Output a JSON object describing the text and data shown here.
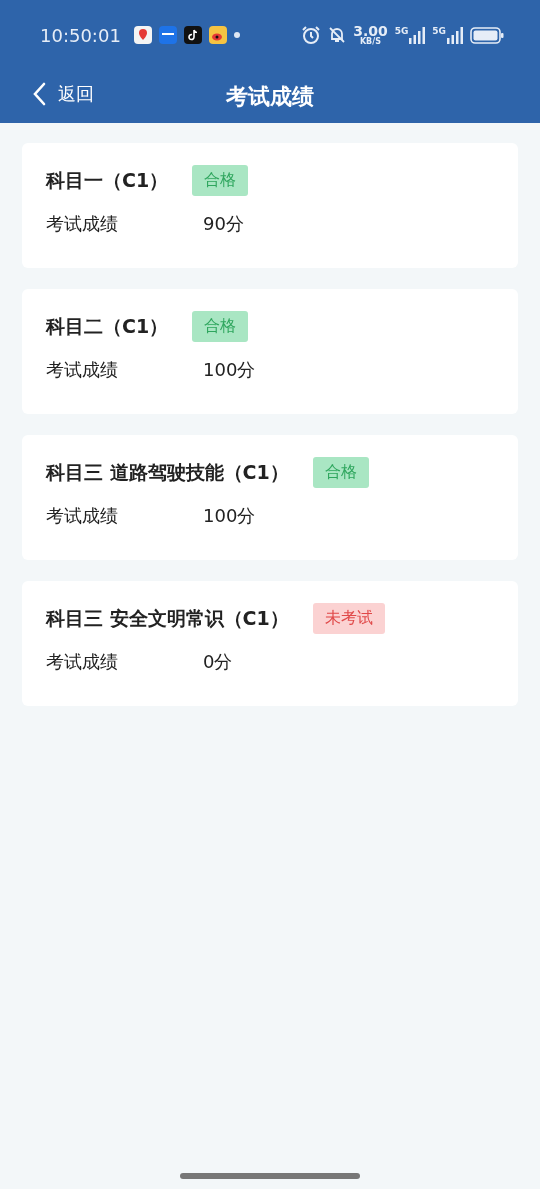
{
  "status_bar": {
    "time": "10:50:01",
    "speed": "3.00",
    "speed_unit": "KB/S",
    "networks": [
      "5G",
      "5G"
    ]
  },
  "nav": {
    "back": "返回",
    "title": "考试成绩"
  },
  "cards": [
    {
      "subject": "科目一（C1）",
      "badge": "合格",
      "kind": "pass",
      "label": "考试成绩",
      "score": "90分"
    },
    {
      "subject": "科目二（C1）",
      "badge": "合格",
      "kind": "pass",
      "label": "考试成绩",
      "score": "100分"
    },
    {
      "subject": "科目三 道路驾驶技能（C1）",
      "badge": "合格",
      "kind": "pass",
      "label": "考试成绩",
      "score": "100分"
    },
    {
      "subject": "科目三 安全文明常识（C1）",
      "badge": "未考试",
      "kind": "pending",
      "label": "考试成绩",
      "score": "0分"
    }
  ]
}
